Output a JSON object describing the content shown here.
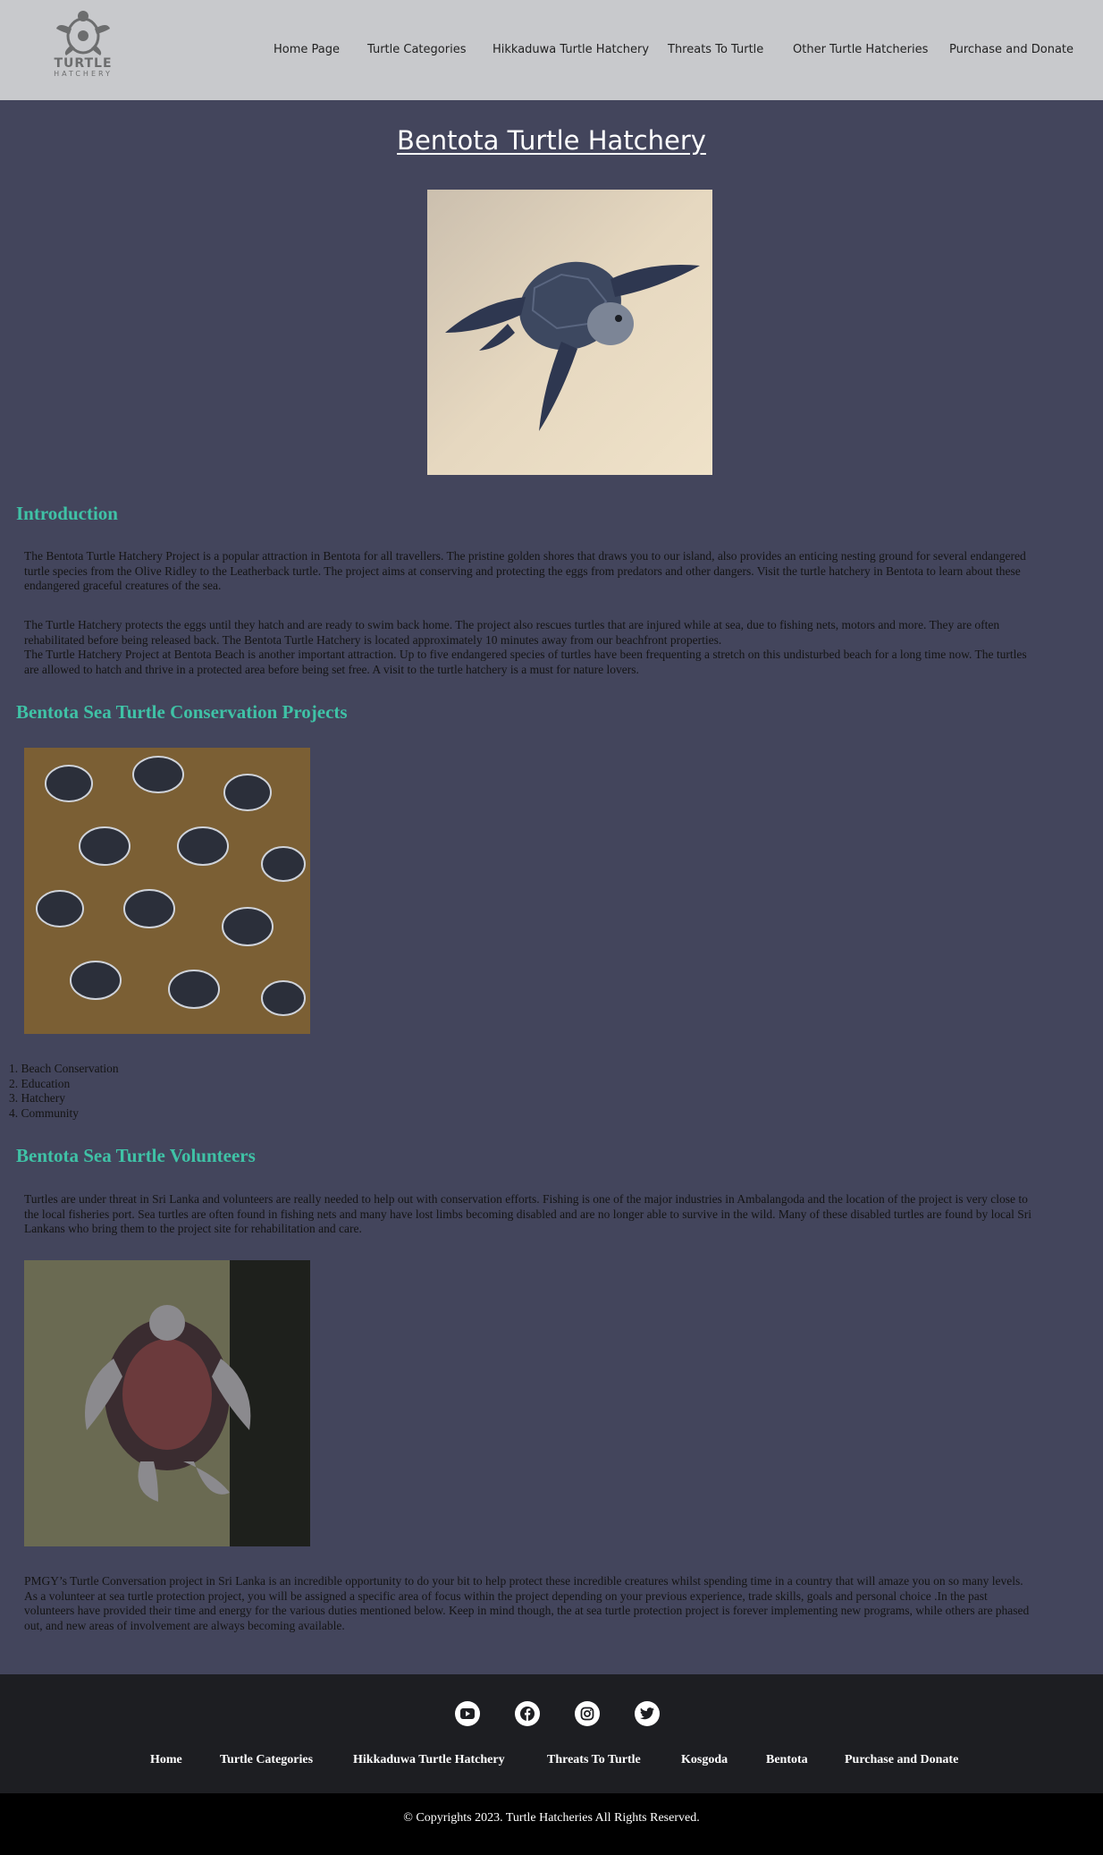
{
  "header": {
    "logo_word": "TURTLE",
    "logo_sub": "HATCHERY",
    "nav": [
      "Home Page",
      "Turtle Categories",
      "Hikkaduwa Turtle Hatchery",
      "Threats To Turtle",
      "Other Turtle Hatcheries",
      "Purchase and Donate"
    ]
  },
  "main": {
    "title": "Bentota Turtle Hatchery",
    "intro_heading": "Introduction",
    "intro_p1": [
      "The Bentota Turtle Hatchery Project is a popular attraction in Bentota for all travellers. The pristine golden shores that draws you to our island, also provides an enticing nesting ground for several endangered",
      "turtle species from the Olive Ridley to the Leatherback turtle. The project aims at conserving and protecting the eggs from predators and other dangers. Visit the turtle hatchery in Bentota to learn about these",
      "endangered graceful creatures of the sea."
    ],
    "intro_p2": [
      "The Turtle Hatchery protects the eggs until they hatch and are ready to swim back home. The project also rescues turtles that are injured while at sea, due to fishing nets, motors and more. They are often",
      "rehabilitated before being released back. The Bentota Turtle Hatchery is located approximately 10 minutes away from our beachfront properties.",
      "The Turtle Hatchery Project at Bentota Beach is another important attraction. Up to five endangered species of turtles have been frequenting a stretch on this undisturbed beach for a long time now. The turtles",
      "are allowed to hatch and thrive in a protected area before being set free. A visit to the turtle hatchery is a must for nature lovers."
    ],
    "projects_heading": "Bentota Sea Turtle Conservation Projects",
    "projects_list": [
      "Beach Conservation",
      "Education",
      "Hatchery",
      "Community"
    ],
    "volunteers_heading": "Bentota Sea Turtle Volunteers",
    "volunteers_p1": [
      "Turtles are under threat in Sri Lanka and volunteers are really needed to help out with conservation efforts. Fishing is one of the major industries in Ambalangoda and the location of the project is very close to",
      "the local fisheries port. Sea turtles are often found in fishing nets and many have lost limbs becoming disabled and are no longer able to survive in the wild. Many of these disabled turtles are found by local Sri",
      "Lankans who bring them to the project site for rehabilitation and care."
    ],
    "volunteers_p2": [
      "PMGY’s Turtle Conversation project in Sri Lanka is an incredible opportunity to do your bit to help protect these incredible creatures whilst spending time in a country that will amaze you on so many levels.",
      "As a volunteer at sea turtle protection project, you will be assigned a specific area of focus within the project depending on your previous experience, trade skills, goals and personal choice .In the past",
      "volunteers have provided their time and energy for the various duties mentioned below. Keep in mind though, the at sea turtle protection project is forever implementing new programs, while others are phased",
      "out, and new areas of involvement are always becoming available."
    ]
  },
  "footer": {
    "social_icons": [
      "youtube-icon",
      "facebook-icon",
      "instagram-icon",
      "twitter-icon"
    ],
    "nav": [
      "Home",
      "Turtle Categories",
      "Hikkaduwa Turtle Hatchery",
      "Threats To Turtle",
      "Kosgoda",
      "Bentota",
      "Purchase and Donate"
    ],
    "copyright": "© Copyrights 2023. Turtle Hatcheries All Rights Reserved."
  },
  "colors": {
    "header_bg": "#c8c9cc",
    "page_bg": "#43455c",
    "heading_accent": "#3fc2a6",
    "footer_bg": "#1d1e22",
    "copyright_bg": "#000000"
  }
}
